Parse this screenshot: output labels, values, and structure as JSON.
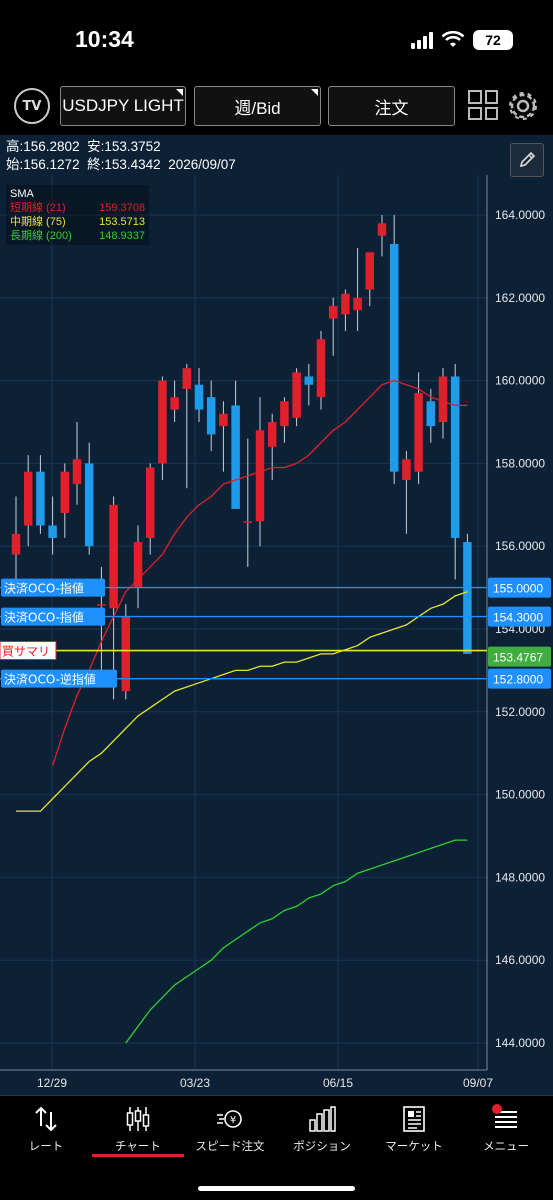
{
  "status_bar": {
    "time": "10:34",
    "battery": "72"
  },
  "toolbar": {
    "logo": "TV",
    "symbol": "USDJPY LIGHT",
    "timeframe": "週/Bid",
    "order": "注文"
  },
  "ohlc": {
    "high_label": "高:",
    "high": "156.2802",
    "low_label": "安:",
    "low": "153.3752",
    "open_label": "始:",
    "open": "156.1272",
    "close_label": "終:",
    "close": "153.4342",
    "date": "2026/09/07"
  },
  "legend": {
    "title": "SMA",
    "items": [
      {
        "label": "短期線 (21)",
        "value": "159.3708",
        "color": "#e0202a"
      },
      {
        "label": "中期線 (75)",
        "value": "153.5713",
        "color": "#e8e62a"
      },
      {
        "label": "長期線 (200)",
        "value": "148.9337",
        "color": "#2ed12e"
      }
    ]
  },
  "price_axis": [
    "164.0000",
    "162.0000",
    "160.0000",
    "158.0000",
    "156.0000",
    "154.0000",
    "152.0000",
    "150.0000",
    "148.0000",
    "146.0000",
    "144.0000"
  ],
  "date_axis": [
    "12/29",
    "03/23",
    "06/15",
    "09/07"
  ],
  "order_lines": [
    {
      "label": "決済OCO-指値",
      "price": 155.0,
      "price_label": "155.0000",
      "color": "#1e90ff"
    },
    {
      "label": "決済OCO-指値",
      "price": 154.3,
      "price_label": "154.3000",
      "color": "#1e90ff"
    },
    {
      "label": "決済OCO-逆指値",
      "price": 152.8,
      "price_label": "152.8000",
      "color": "#1e90ff"
    }
  ],
  "position_line": {
    "label": "買サマリ",
    "price": 153.48,
    "color": "#e8e62a"
  },
  "current_price": {
    "price": 153.4767,
    "price_label": "153.4767",
    "color": "#3fae3f"
  },
  "colors": {
    "up": "#e0202a",
    "down": "#1e9bea",
    "bg": "#0c2136"
  },
  "chart_data": {
    "type": "candlestick",
    "ylim": [
      143.5,
      164.5
    ],
    "candles": [
      [
        155.8,
        157.2,
        154.8,
        156.3
      ],
      [
        156.5,
        158.2,
        156.0,
        157.8
      ],
      [
        157.8,
        158.2,
        156.3,
        156.5
      ],
      [
        156.5,
        157.2,
        155.8,
        156.2
      ],
      [
        156.8,
        158.0,
        156.2,
        157.8
      ],
      [
        157.5,
        159.0,
        157.0,
        158.1
      ],
      [
        158.0,
        158.5,
        155.8,
        156.0
      ],
      [
        154.6,
        155.5,
        152.8,
        154.6
      ],
      [
        154.5,
        157.2,
        152.3,
        157.0
      ],
      [
        152.5,
        154.6,
        152.3,
        154.3
      ],
      [
        155.0,
        156.5,
        154.5,
        156.1
      ],
      [
        156.2,
        158.0,
        155.8,
        157.9
      ],
      [
        158.0,
        160.1,
        157.6,
        160.0
      ],
      [
        159.3,
        160.0,
        159.0,
        159.6
      ],
      [
        159.8,
        160.4,
        157.4,
        160.3
      ],
      [
        159.9,
        160.3,
        159.0,
        159.3
      ],
      [
        159.6,
        160.0,
        158.3,
        158.7
      ],
      [
        158.9,
        159.5,
        157.8,
        159.2
      ],
      [
        159.4,
        160.0,
        157.0,
        156.9
      ],
      [
        156.6,
        158.6,
        155.5,
        156.6
      ],
      [
        156.6,
        159.6,
        156.0,
        158.8
      ],
      [
        158.4,
        159.2,
        157.6,
        159.0
      ],
      [
        158.9,
        159.6,
        158.5,
        159.5
      ],
      [
        159.1,
        160.3,
        158.9,
        160.2
      ],
      [
        160.1,
        160.4,
        159.4,
        159.9
      ],
      [
        159.6,
        161.2,
        159.3,
        161.0
      ],
      [
        161.5,
        162.0,
        160.6,
        161.8
      ],
      [
        161.6,
        162.2,
        161.2,
        162.1
      ],
      [
        161.7,
        163.2,
        161.2,
        162.0
      ],
      [
        162.2,
        163.0,
        161.8,
        163.1
      ],
      [
        163.5,
        164.0,
        163.0,
        163.8
      ],
      [
        163.3,
        164.0,
        157.5,
        157.8
      ],
      [
        157.6,
        158.3,
        156.3,
        158.1
      ],
      [
        157.8,
        160.2,
        157.5,
        159.7
      ],
      [
        159.5,
        159.8,
        158.5,
        158.9
      ],
      [
        159.0,
        160.3,
        158.6,
        160.1
      ],
      [
        160.1,
        160.4,
        155.2,
        156.2
      ],
      [
        156.1,
        156.3,
        153.4,
        153.4
      ]
    ],
    "sma21": [
      150.7,
      151.6,
      152.4,
      153.0,
      153.7,
      154.3,
      154.9,
      155.2,
      155.5,
      155.8,
      156.3,
      156.7,
      157.0,
      157.2,
      157.5,
      157.6,
      157.7,
      157.8,
      157.9,
      157.9,
      158.0,
      158.2,
      158.5,
      158.8,
      159.0,
      159.3,
      159.6,
      159.9,
      160.0,
      159.9,
      159.8,
      159.6,
      159.5,
      159.4,
      159.4
    ],
    "sma75": [
      149.6,
      149.6,
      149.6,
      149.9,
      150.2,
      150.5,
      150.8,
      151.0,
      151.3,
      151.6,
      151.9,
      152.1,
      152.3,
      152.5,
      152.6,
      152.7,
      152.8,
      152.9,
      153.0,
      153.0,
      153.1,
      153.1,
      153.2,
      153.2,
      153.3,
      153.4,
      153.4,
      153.5,
      153.6,
      153.8,
      153.9,
      154.0,
      154.1,
      154.3,
      154.5,
      154.6,
      154.8,
      154.9
    ],
    "sma200": [
      144.0,
      144.4,
      144.8,
      145.1,
      145.4,
      145.6,
      145.8,
      146.0,
      146.3,
      146.5,
      146.7,
      146.9,
      147.0,
      147.2,
      147.3,
      147.5,
      147.6,
      147.8,
      147.9,
      148.1,
      148.2,
      148.3,
      148.4,
      148.5,
      148.6,
      148.7,
      148.8,
      148.9,
      148.9
    ]
  },
  "nav": [
    {
      "label": "レート",
      "icon": "rate-arrows-icon"
    },
    {
      "label": "チャート",
      "icon": "candlestick-icon"
    },
    {
      "label": "スピード注文",
      "icon": "speed-order-icon"
    },
    {
      "label": "ポジション",
      "icon": "position-bars-icon"
    },
    {
      "label": "マーケット",
      "icon": "news-icon"
    },
    {
      "label": "メニュー",
      "icon": "menu-icon"
    }
  ]
}
